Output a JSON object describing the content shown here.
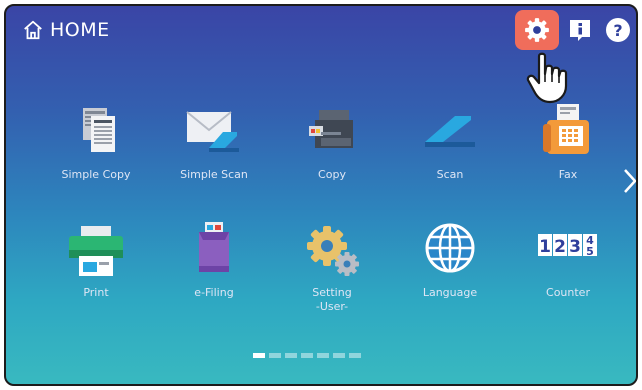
{
  "header": {
    "home_label": "HOME",
    "help_label": "?"
  },
  "tiles_row1": [
    {
      "label": "Simple Copy",
      "icon": "simple-copy-icon"
    },
    {
      "label": "Simple Scan",
      "icon": "simple-scan-icon"
    },
    {
      "label": "Copy",
      "icon": "copy-icon"
    },
    {
      "label": "Scan",
      "icon": "scan-icon"
    },
    {
      "label": "Fax",
      "icon": "fax-icon"
    }
  ],
  "tiles_row2": [
    {
      "label": "Print",
      "icon": "print-icon"
    },
    {
      "label": "e-Filing",
      "icon": "e-filing-icon"
    },
    {
      "label": "Setting",
      "label2": "-User-",
      "icon": "setting-user-icon"
    },
    {
      "label": "Language",
      "icon": "language-icon"
    },
    {
      "label": "Counter",
      "icon": "counter-icon",
      "digits": "123",
      "fraction_top": "4",
      "fraction_bottom": "5"
    }
  ],
  "pager": {
    "pages": 7,
    "active_index": 0
  },
  "colors": {
    "highlight": "#f06d5b",
    "bg_top": "#3a45a6",
    "bg_bottom": "#39b9c0"
  }
}
